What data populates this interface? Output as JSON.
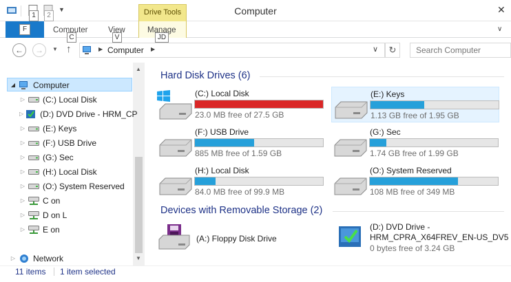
{
  "window": {
    "title": "Computer",
    "contextual_tab": "Drive Tools"
  },
  "qat": {
    "hint_1": "1",
    "hint_2": "2"
  },
  "ribbon": {
    "file_label": "F",
    "tabs": [
      {
        "label": "Computer",
        "hint": "C"
      },
      {
        "label": "View",
        "hint": "V"
      },
      {
        "label": "Manage",
        "hint": "JD"
      }
    ]
  },
  "address": {
    "path": "Computer",
    "search_placeholder": "Search Computer"
  },
  "nav": {
    "items": [
      {
        "label": "Computer",
        "icon": "computer-icon",
        "expanded": true
      },
      {
        "label": "(C:) Local Disk",
        "icon": "hard-disk-icon"
      },
      {
        "label": "(D:) DVD Drive - HRM_CP",
        "icon": "dvd-drive-icon"
      },
      {
        "label": "(E:) Keys",
        "icon": "usb-drive-icon"
      },
      {
        "label": "(F:) USB Drive",
        "icon": "usb-drive-icon"
      },
      {
        "label": "(G:) Sec",
        "icon": "usb-drive-icon"
      },
      {
        "label": "(H:) Local Disk",
        "icon": "hard-disk-icon"
      },
      {
        "label": "(O:) System Reserved",
        "icon": "hard-disk-icon"
      },
      {
        "label": "C on",
        "icon": "network-drive-icon"
      },
      {
        "label": "D on L",
        "icon": "network-drive-icon"
      },
      {
        "label": "E on",
        "icon": "network-drive-icon"
      },
      {
        "label": "Network",
        "icon": "network-icon"
      }
    ]
  },
  "groups": {
    "hdd_title": "Hard Disk Drives (6)",
    "removable_title": "Devices with Removable Storage (2)"
  },
  "drives": [
    {
      "name": "(C:) Local Disk",
      "free": "23.0 MB free of 27.5 GB",
      "used_fraction": 0.999,
      "bar_color": "#da2626",
      "icon": "windows-disk-icon"
    },
    {
      "name": "(E:) Keys",
      "free": "1.13 GB free of 1.95 GB",
      "used_fraction": 0.42,
      "bar_color": "#26a0da",
      "icon": "hard-disk-icon",
      "selected": true
    },
    {
      "name": "(F:) USB Drive",
      "free": "885 MB free of 1.59 GB",
      "used_fraction": 0.46,
      "bar_color": "#26a0da",
      "icon": "hard-disk-icon"
    },
    {
      "name": "(G:) Sec",
      "free": "1.74 GB free of 1.99 GB",
      "used_fraction": 0.13,
      "bar_color": "#26a0da",
      "icon": "hard-disk-icon"
    },
    {
      "name": "(H:) Local Disk",
      "free": "84.0 MB free of 99.9 MB",
      "used_fraction": 0.16,
      "bar_color": "#26a0da",
      "icon": "hard-disk-icon"
    },
    {
      "name": "(O:) System Reserved",
      "free": "108 MB free of 349 MB",
      "used_fraction": 0.69,
      "bar_color": "#26a0da",
      "icon": "hard-disk-icon"
    }
  ],
  "removable": [
    {
      "name": "(A:) Floppy Disk Drive",
      "icon": "floppy-drive-icon"
    },
    {
      "name_line1": "(D:) DVD Drive -",
      "name_line2": "HRM_CPRA_X64FREV_EN-US_DV5",
      "free": "0 bytes free of 3.24 GB",
      "icon": "dvd-drive-icon"
    }
  ],
  "status": {
    "count": "11 items",
    "selected": "1 item selected"
  }
}
